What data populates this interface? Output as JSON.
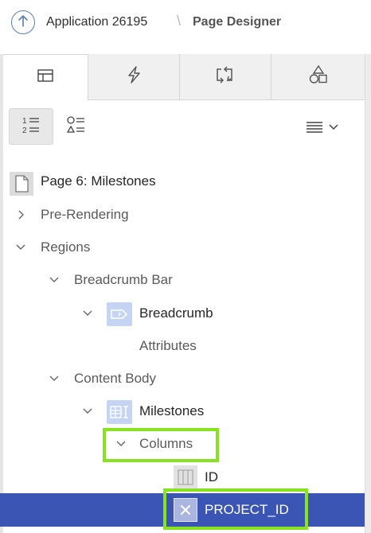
{
  "header": {
    "app_title": "Application 26195",
    "separator": "\\",
    "page_title": "Page Designer"
  },
  "tabs": [
    {
      "name": "rendering",
      "icon": "rendering-tree-icon",
      "active": true
    },
    {
      "name": "dynamic-actions",
      "icon": "lightning-icon",
      "active": false
    },
    {
      "name": "processing",
      "icon": "processing-arrows-icon",
      "active": false
    },
    {
      "name": "shared-components",
      "icon": "shapes-icon",
      "active": false
    }
  ],
  "toolbar": {
    "views": [
      {
        "icon": "ordered-list-icon",
        "active": true
      },
      {
        "icon": "component-list-icon",
        "active": false
      }
    ],
    "menu_icon": "menu-lines-icon"
  },
  "tree": {
    "page": "Page 6: Milestones",
    "pre_rendering": "Pre-Rendering",
    "regions": "Regions",
    "breadcrumb_bar": "Breadcrumb Bar",
    "breadcrumb": "Breadcrumb",
    "attributes": "Attributes",
    "content_body": "Content Body",
    "milestones": "Milestones",
    "columns": "Columns",
    "id_column": "ID",
    "project_id_column": "PROJECT_ID"
  },
  "colors": {
    "selection": "#3b55b4",
    "highlight": "#86e31d",
    "accent": "#5a7fb5"
  }
}
